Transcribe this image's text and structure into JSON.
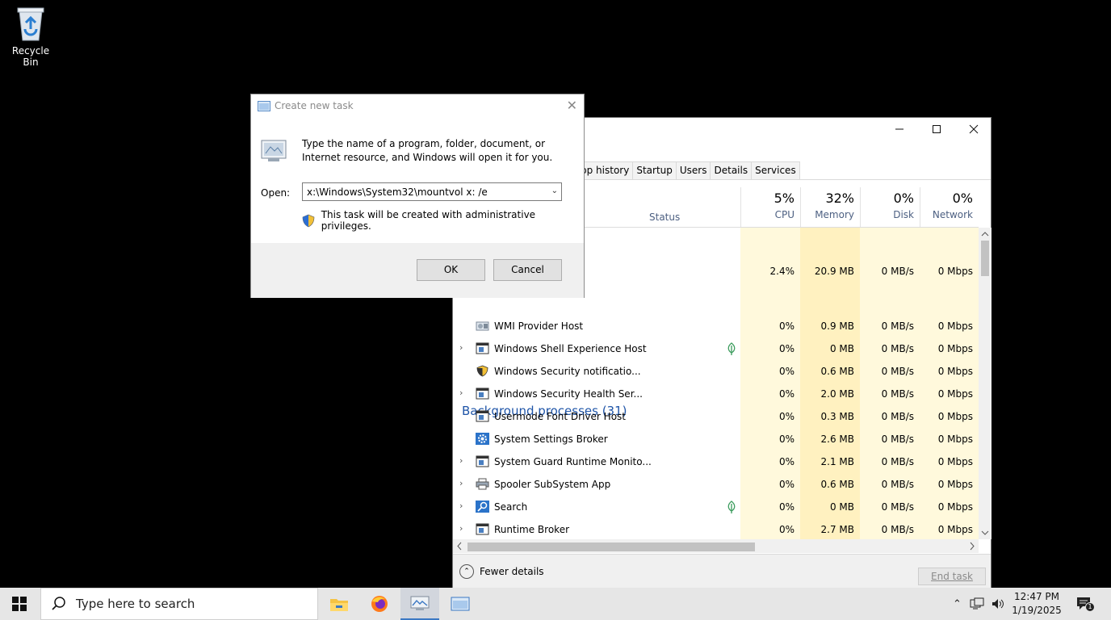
{
  "desktop": {
    "recycle_bin_label": "Recycle Bin"
  },
  "task_manager": {
    "tabs": [
      "pp history",
      "Startup",
      "Users",
      "Details",
      "Services"
    ],
    "columns": {
      "status": "Status",
      "cpu": {
        "pct": "5%",
        "label": "CPU"
      },
      "memory": {
        "pct": "32%",
        "label": "Memory"
      },
      "disk": {
        "pct": "0%",
        "label": "Disk"
      },
      "network": {
        "pct": "0%",
        "label": "Network"
      }
    },
    "app_row": {
      "cpu": "2.4%",
      "memory": "20.9 MB",
      "disk": "0 MB/s",
      "network": "0 Mbps"
    },
    "background_group": "Background processes (31)",
    "processes": [
      {
        "name": "WMI Provider Host",
        "expand": "",
        "leaf": false,
        "icon": "wmi-icon",
        "cpu": "0%",
        "memory": "0.9 MB",
        "disk": "0 MB/s",
        "network": "0 Mbps"
      },
      {
        "name": "Windows Shell Experience Host",
        "expand": "›",
        "leaf": true,
        "icon": "window-icon",
        "cpu": "0%",
        "memory": "0 MB",
        "disk": "0 MB/s",
        "network": "0 Mbps"
      },
      {
        "name": "Windows Security notificatio...",
        "expand": "",
        "leaf": false,
        "icon": "shield-icon",
        "cpu": "0%",
        "memory": "0.6 MB",
        "disk": "0 MB/s",
        "network": "0 Mbps"
      },
      {
        "name": "Windows Security Health Ser...",
        "expand": "›",
        "leaf": false,
        "icon": "window-icon",
        "cpu": "0%",
        "memory": "2.0 MB",
        "disk": "0 MB/s",
        "network": "0 Mbps"
      },
      {
        "name": "Usermode Font Driver Host",
        "expand": "",
        "leaf": false,
        "icon": "window-icon",
        "cpu": "0%",
        "memory": "0.3 MB",
        "disk": "0 MB/s",
        "network": "0 Mbps"
      },
      {
        "name": "System Settings Broker",
        "expand": "",
        "leaf": false,
        "icon": "gear-icon",
        "cpu": "0%",
        "memory": "2.6 MB",
        "disk": "0 MB/s",
        "network": "0 Mbps"
      },
      {
        "name": "System Guard Runtime Monito...",
        "expand": "›",
        "leaf": false,
        "icon": "window-icon",
        "cpu": "0%",
        "memory": "2.1 MB",
        "disk": "0 MB/s",
        "network": "0 Mbps"
      },
      {
        "name": "Spooler SubSystem App",
        "expand": "›",
        "leaf": false,
        "icon": "printer-icon",
        "cpu": "0%",
        "memory": "0.6 MB",
        "disk": "0 MB/s",
        "network": "0 Mbps"
      },
      {
        "name": "Search",
        "expand": "›",
        "leaf": true,
        "icon": "search-icon",
        "cpu": "0%",
        "memory": "0 MB",
        "disk": "0 MB/s",
        "network": "0 Mbps"
      },
      {
        "name": "Runtime Broker",
        "expand": "›",
        "leaf": false,
        "icon": "window-icon",
        "cpu": "0%",
        "memory": "2.7 MB",
        "disk": "0 MB/s",
        "network": "0 Mbps"
      }
    ],
    "fewer_details": "Fewer details",
    "end_task": "End task"
  },
  "run_dialog": {
    "title": "Create new task",
    "description": "Type the name of a program, folder, document, or Internet resource, and Windows will open it for you.",
    "open_label": "Open:",
    "open_value": "x:\\Windows\\System32\\mountvol x: /e",
    "admin_note": "This task will be created with administrative privileges.",
    "ok": "OK",
    "cancel": "Cancel"
  },
  "taskbar": {
    "search_placeholder": "Type here to search",
    "time": "12:47 PM",
    "date": "1/19/2025",
    "notification_count": "1"
  },
  "colors": {
    "heat_light": "#fff9dc",
    "heat_mid": "#fff1c0",
    "heat_memory": "#fdeeb4",
    "accent_blue": "#1f55a8"
  }
}
